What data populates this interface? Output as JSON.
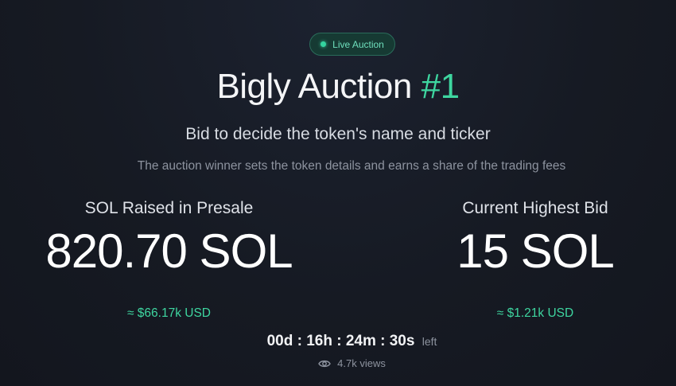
{
  "badge": {
    "label": "Live Auction",
    "dot_color": "#34d39e"
  },
  "header": {
    "title_text": "Bigly Auction",
    "title_number": "#1",
    "subtitle": "Bid to decide the token's name and ticker",
    "description": "The auction winner sets the token details and earns a share of the trading fees"
  },
  "stats": {
    "presale": {
      "label": "SOL Raised in Presale",
      "value": "820.70 SOL",
      "usd": "≈ $66.17k USD"
    },
    "highest_bid": {
      "label": "Current Highest Bid",
      "value": "15 SOL",
      "usd": "≈ $1.21k USD"
    }
  },
  "countdown": {
    "time": "00d : 16h : 24m : 30s",
    "suffix": "left"
  },
  "views": {
    "icon": "eye-icon",
    "count": "4.7k views"
  },
  "colors": {
    "accent": "#3ed6a0",
    "background": "#161a23"
  }
}
